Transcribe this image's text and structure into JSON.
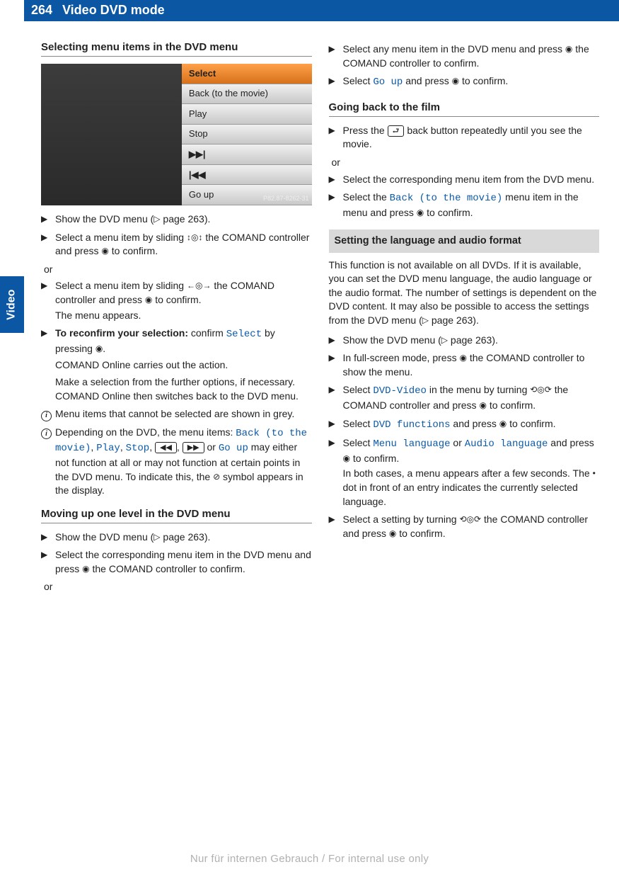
{
  "page_number": "264",
  "header_title": "Video DVD mode",
  "side_tab": "Video",
  "screenshot": {
    "items": [
      "Select",
      "Back (to the movie)",
      "Play",
      "Stop",
      "▶▶|",
      "|◀◀",
      "Go up"
    ],
    "tag": "P82.87-8262-31"
  },
  "col1": {
    "h1": "Selecting menu items in the DVD menu",
    "s1a": "Show the DVD menu (",
    "s1b": " page 263).",
    "s2a": "Select a menu item by sliding ",
    "s2b": " the COMAND controller and press ",
    "s2c": " to confirm.",
    "or": "or",
    "s3a": "Select a menu item by sliding ",
    "s3b": " the COMAND controller and press ",
    "s3c": " to confirm.",
    "s3d": "The menu appears.",
    "s4a": "To reconfirm your selection:",
    "s4b": " confirm ",
    "s4c": "Select",
    "s4d": " by pressing ",
    "s4e": ".",
    "s4f": "COMAND Online carries out the action.",
    "s4g": "Make a selection from the further options, if necessary.",
    "s4h": "COMAND Online then switches back to the DVD menu.",
    "n1": "Menu items that cannot be selected are shown in grey.",
    "n2a": "Depending on the DVD, the menu items: ",
    "n2_back": "Back (to the movie)",
    "n2_play": "Play",
    "n2_stop": "Stop",
    "n2_goup": "Go up",
    "n2b": " may either not function at all or may not function at certain points in the DVD menu. To indicate this, the ",
    "n2c": " symbol appears in the display.",
    "h2": "Moving up one level in the DVD menu",
    "m1a": "Show the DVD menu (",
    "m1b": " page 263).",
    "m2a": "Select the corresponding menu item in the DVD menu and press ",
    "m2b": " the COMAND controller to confirm."
  },
  "col2": {
    "s1a": "Select any menu item in the DVD menu and press ",
    "s1b": " the COMAND controller to confirm.",
    "s2a": "Select ",
    "s2_goup": "Go up",
    "s2b": " and press ",
    "s2c": " to confirm.",
    "h1": "Going back to the film",
    "g1a": "Press the ",
    "g1b": " back button repeatedly until you see the movie.",
    "or": "or",
    "g2": "Select the corresponding menu item from the DVD menu.",
    "g3a": "Select the ",
    "g3_back": "Back (to the movie)",
    "g3b": " menu item in the menu and press ",
    "g3c": " to confirm.",
    "sec_head": "Setting the language and audio format",
    "p1a": "This function is not available on all DVDs. If it is available, you can set the DVD menu language, the audio language or the audio format. The number of settings is dependent on the DVD content. It may also be possible to access the settings from the DVD menu (",
    "p1b": " page 263).",
    "l1a": "Show the DVD menu (",
    "l1b": " page 263).",
    "l2a": "In full-screen mode, press ",
    "l2b": " the COMAND controller to show the menu.",
    "l3a": "Select ",
    "l3_dvd": "DVD-Video",
    "l3b": " in the menu by turning ",
    "l3c": " the COMAND controller and press ",
    "l3d": " to confirm.",
    "l4a": "Select ",
    "l4_fn": "DVD functions",
    "l4b": " and press ",
    "l4c": " to confirm.",
    "l5a": "Select ",
    "l5_ml": "Menu language",
    "l5_or": " or ",
    "l5_al": "Audio language",
    "l5b": " and press ",
    "l5c": " to confirm.",
    "l5d": "In both cases, a menu appears after a few seconds. The ",
    "l5e": " dot in front of an entry indicates the currently selected language.",
    "l6a": "Select a setting by turning ",
    "l6b": " the COMAND controller and press ",
    "l6c": " to confirm."
  },
  "footer": "Nur für internen Gebrauch / For internal use only",
  "glyphs": {
    "tri": "▶",
    "xref": "▷",
    "press": "◉",
    "updown": "↕◎↕",
    "leftright": "←◎→",
    "turn": "⟲◎⟳",
    "back_key": "⮐",
    "rew": "◀◀",
    "fwd": "▶▶",
    "prohibit": "⊘",
    "dot": "•"
  }
}
